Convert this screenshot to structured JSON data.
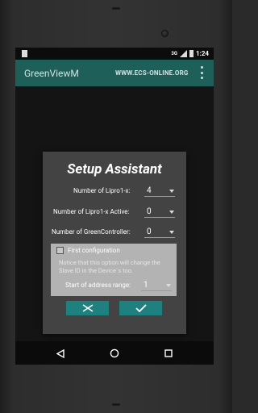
{
  "status_bar": {
    "signal": "3G",
    "time": "1:24"
  },
  "toolbar": {
    "title": "GreenViewM",
    "url": "WWW.ECS-ONLINE.ORG"
  },
  "dialog": {
    "title": "Setup Assistant",
    "lipro_count": {
      "label": "Number of Lipro1-x:",
      "value": "4"
    },
    "lipro_active": {
      "label": "Number of Lipro1-x Active:",
      "value": "0"
    },
    "greencontroller": {
      "label": "Number of GreenController:",
      "value": "0"
    },
    "config": {
      "checkbox_label": "First configuration",
      "checked": false,
      "note": "Notice that this option will change the Slave ID in the Device´s too.",
      "start_label": "Start of address range:",
      "start_value": "1"
    }
  },
  "colors": {
    "accent": "#1f5f5a",
    "button": "#1f8080",
    "dialog_bg": "#434343"
  }
}
